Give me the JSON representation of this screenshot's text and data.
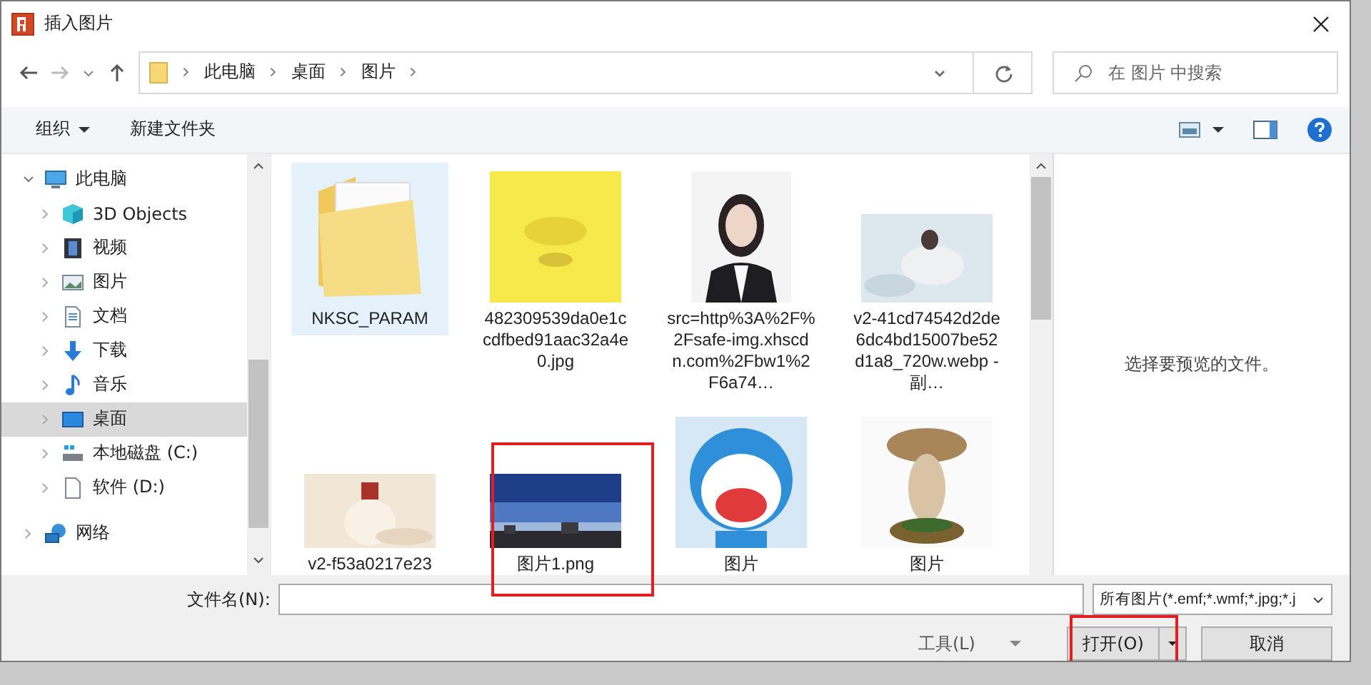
{
  "window": {
    "title": "插入图片"
  },
  "address_bar": {
    "path": [
      "此电脑",
      "桌面",
      "图片"
    ]
  },
  "search": {
    "placeholder": "在 图片 中搜索"
  },
  "toolbar": {
    "organize": "组织",
    "new_folder": "新建文件夹"
  },
  "nav": {
    "items": [
      {
        "label": "此电脑",
        "kind": "computer",
        "expanded": true,
        "selected": false,
        "children": [
          {
            "label": "3D Objects",
            "kind": "cube",
            "expanded": false,
            "selected": false
          },
          {
            "label": "视频",
            "kind": "video",
            "expanded": false,
            "selected": false
          },
          {
            "label": "图片",
            "kind": "pictures",
            "expanded": false,
            "selected": false
          },
          {
            "label": "文档",
            "kind": "document",
            "expanded": false,
            "selected": false
          },
          {
            "label": "下载",
            "kind": "download",
            "expanded": false,
            "selected": false
          },
          {
            "label": "音乐",
            "kind": "music",
            "expanded": false,
            "selected": false
          },
          {
            "label": "桌面",
            "kind": "desktop",
            "expanded": false,
            "selected": true
          },
          {
            "label": "本地磁盘 (C:)",
            "kind": "drive",
            "expanded": false,
            "selected": false
          },
          {
            "label": "软件 (D:)",
            "kind": "file",
            "expanded": false,
            "selected": false
          }
        ]
      },
      {
        "label": "网络",
        "kind": "network",
        "expanded": false,
        "selected": false
      }
    ]
  },
  "files": [
    {
      "name": "NKSC_PARAM",
      "kind": "folder",
      "selected": true
    },
    {
      "name": "482309539da0e1ccdfbed91aac32a4e0.jpg",
      "kind": "picture",
      "selected": false
    },
    {
      "name": "src=http%3A%2F%2Fsafe-img.xhscdn.com%2Fbw1%2F6a74…",
      "kind": "picture",
      "selected": false
    },
    {
      "name": "v2-41cd74542d2de6dc4bd15007be52d1a8_720w.webp - 副…",
      "kind": "picture",
      "selected": false
    },
    {
      "name": "v2-f53a0217e23",
      "kind": "picture",
      "selected": false
    },
    {
      "name": "图片1.png",
      "kind": "picture",
      "selected": false
    },
    {
      "name": "图片",
      "kind": "picture",
      "selected": false
    },
    {
      "name": "图片",
      "kind": "picture",
      "selected": false
    }
  ],
  "preview": {
    "message": "选择要预览的文件。"
  },
  "footer": {
    "filename_label": "文件名(N):",
    "filter": "所有图片(*.emf;*.wmf;*.jpg;*.j",
    "tools": "工具(L)",
    "open": "打开(O)",
    "cancel": "取消"
  }
}
